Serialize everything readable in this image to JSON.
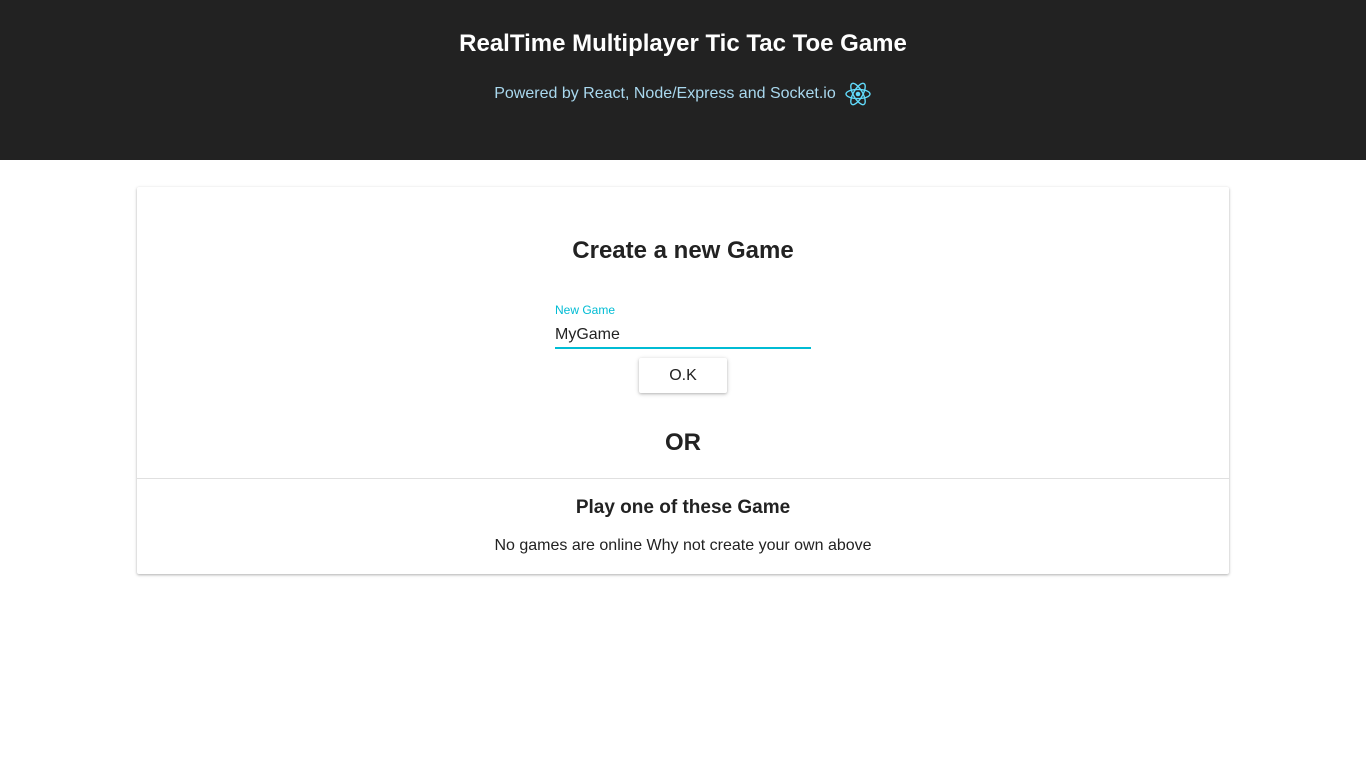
{
  "header": {
    "title": "RealTime Multiplayer Tic Tac Toe Game",
    "subtitle": "Powered by React, Node/Express and Socket.io",
    "logo_icon": "react-logo-icon",
    "background_color": "#222222",
    "subtitle_color": "#a9d8ee"
  },
  "create": {
    "title": "Create a new Game",
    "field_label": "New Game",
    "field_value": "MyGame",
    "accent_color": "#00bcd4",
    "ok_label": "O.K"
  },
  "separator": {
    "or_label": "OR"
  },
  "join": {
    "title": "Play one of these Game",
    "empty_message": "No games are online Why not create your own above"
  }
}
